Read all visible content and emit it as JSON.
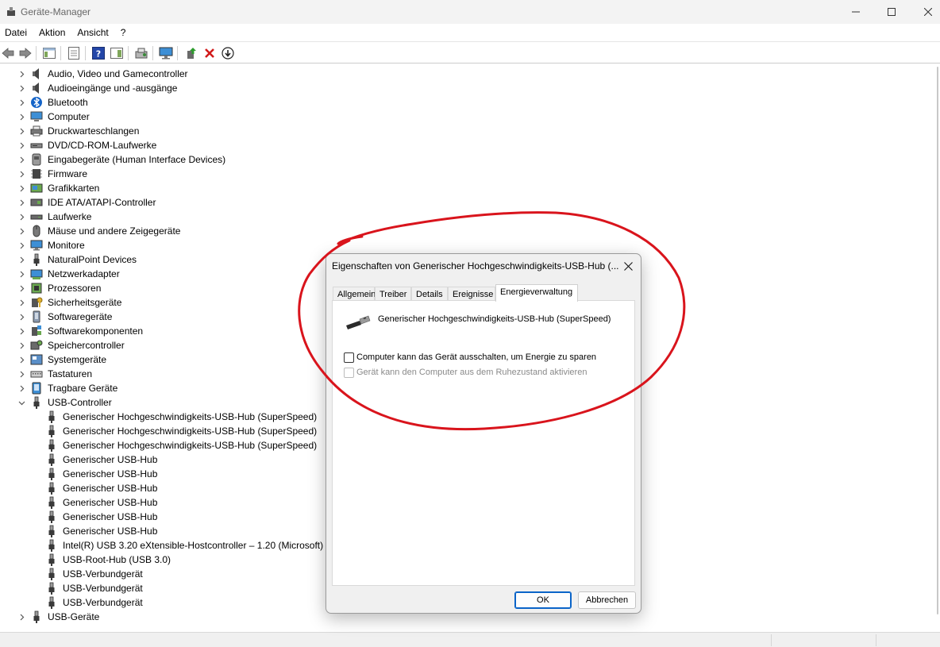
{
  "window": {
    "title": "Geräte-Manager"
  },
  "menu": [
    "Datei",
    "Aktion",
    "Ansicht",
    "?"
  ],
  "tree": {
    "categories": [
      {
        "label": "Audio, Video und Gamecontroller",
        "icon": "speaker-icon"
      },
      {
        "label": "Audioeingänge und -ausgänge",
        "icon": "speaker-icon"
      },
      {
        "label": "Bluetooth",
        "icon": "bluetooth-icon"
      },
      {
        "label": "Computer",
        "icon": "computer-icon"
      },
      {
        "label": "Druckwarteschlangen",
        "icon": "printer-icon"
      },
      {
        "label": "DVD/CD-ROM-Laufwerke",
        "icon": "dvd-drive-icon"
      },
      {
        "label": "Eingabegeräte (Human Interface Devices)",
        "icon": "hid-icon"
      },
      {
        "label": "Firmware",
        "icon": "firmware-icon"
      },
      {
        "label": "Grafikkarten",
        "icon": "display-adapter-icon"
      },
      {
        "label": "IDE ATA/ATAPI-Controller",
        "icon": "ide-controller-icon"
      },
      {
        "label": "Laufwerke",
        "icon": "disk-drive-icon"
      },
      {
        "label": "Mäuse und andere Zeigegeräte",
        "icon": "mouse-icon"
      },
      {
        "label": "Monitore",
        "icon": "monitor-icon"
      },
      {
        "label": "NaturalPoint Devices",
        "icon": "usb-plug-icon"
      },
      {
        "label": "Netzwerkadapter",
        "icon": "network-adapter-icon"
      },
      {
        "label": "Prozessoren",
        "icon": "processor-icon"
      },
      {
        "label": "Sicherheitsgeräte",
        "icon": "security-device-icon"
      },
      {
        "label": "Softwaregeräte",
        "icon": "software-device-icon"
      },
      {
        "label": "Softwarekomponenten",
        "icon": "software-component-icon"
      },
      {
        "label": "Speichercontroller",
        "icon": "storage-controller-icon"
      },
      {
        "label": "Systemgeräte",
        "icon": "system-device-icon"
      },
      {
        "label": "Tastaturen",
        "icon": "keyboard-icon"
      },
      {
        "label": "Tragbare Geräte",
        "icon": "portable-device-icon"
      },
      {
        "label": "USB-Controller",
        "icon": "usb-plug-icon",
        "expanded": true
      }
    ],
    "usb_children": [
      "Generischer Hochgeschwindigkeits-USB-Hub (SuperSpeed)",
      "Generischer Hochgeschwindigkeits-USB-Hub (SuperSpeed)",
      "Generischer Hochgeschwindigkeits-USB-Hub (SuperSpeed)",
      "Generischer USB-Hub",
      "Generischer USB-Hub",
      "Generischer USB-Hub",
      "Generischer USB-Hub",
      "Generischer USB-Hub",
      "Generischer USB-Hub",
      "Intel(R) USB 3.20 eXtensible-Hostcontroller – 1.20 (Microsoft)",
      "USB-Root-Hub (USB 3.0)",
      "USB-Verbundgerät",
      "USB-Verbundgerät",
      "USB-Verbundgerät"
    ],
    "last_category": {
      "label": "USB-Geräte",
      "icon": "usb-plug-icon"
    }
  },
  "dialog": {
    "title": "Eigenschaften von Generischer Hochgeschwindigkeits-USB-Hub (...",
    "tabs": [
      "Allgemein",
      "Treiber",
      "Details",
      "Ereignisse",
      "Energieverwaltung"
    ],
    "active_tab": "Energieverwaltung",
    "device_name": "Generischer Hochgeschwindigkeits-USB-Hub (SuperSpeed)",
    "options": [
      {
        "label": "Computer kann das Gerät ausschalten, um Energie zu sparen",
        "checked": false,
        "enabled": true
      },
      {
        "label": "Gerät kann den Computer aus dem Ruhezustand aktivieren",
        "checked": false,
        "enabled": false
      }
    ],
    "ok_label": "OK",
    "cancel_label": "Abbrechen"
  },
  "colors": {
    "annotation_red": "#d9141c",
    "accent_blue": "#0a64c8"
  }
}
